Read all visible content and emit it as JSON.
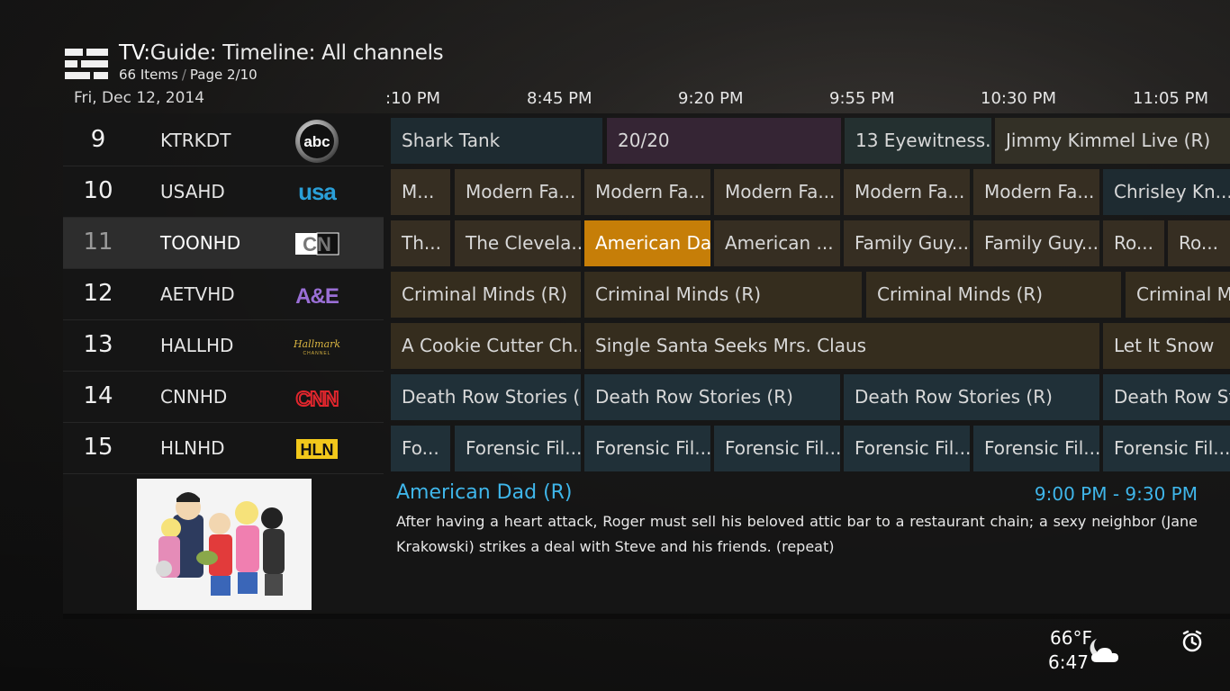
{
  "header": {
    "title_prefix": "TV:",
    "title_main": "Guide: Timeline: All channels",
    "items": "66 Items",
    "separator": "/",
    "page": "Page 2/10"
  },
  "date": "Fri, Dec 12, 2014",
  "timeline": [
    ":10 PM",
    "8:45 PM",
    "9:20 PM",
    "9:55 PM",
    "10:30 PM",
    "11:05 PM"
  ],
  "channels": [
    {
      "number": "9",
      "name": "KTRKDT",
      "logo": "abc",
      "active": false
    },
    {
      "number": "10",
      "name": "USAHD",
      "logo": "usa",
      "active": false
    },
    {
      "number": "11",
      "name": "TOONHD",
      "logo": "cn",
      "active": true
    },
    {
      "number": "12",
      "name": "AETVHD",
      "logo": "ae",
      "active": false
    },
    {
      "number": "13",
      "name": "HALLHD",
      "logo": "hallmark",
      "active": false
    },
    {
      "number": "14",
      "name": "CNNHD",
      "logo": "cnn",
      "active": false
    },
    {
      "number": "15",
      "name": "HLNHD",
      "logo": "hln",
      "active": false
    }
  ],
  "logos": {
    "abc": "abc",
    "usa": "usa",
    "cn": "CN",
    "ae": "A&E",
    "hallmark": "Hallmark",
    "hallmark_sub": "CHANNEL",
    "cnn": "CNN",
    "hln": "HLN"
  },
  "programs": [
    [
      {
        "title": "Shark Tank",
        "genre": "reality"
      },
      {
        "title": "20/20",
        "genre": "variety"
      },
      {
        "title": "13 Eyewitness...",
        "genre": "local"
      },
      {
        "title": "Jimmy Kimmel Live (R)",
        "genre": "talk"
      }
    ],
    [
      {
        "title": "M...",
        "genre": "comedy"
      },
      {
        "title": "Modern Fa...",
        "genre": "comedy"
      },
      {
        "title": "Modern Fa...",
        "genre": "comedy"
      },
      {
        "title": "Modern Fa...",
        "genre": "comedy"
      },
      {
        "title": "Modern Fa...",
        "genre": "comedy"
      },
      {
        "title": "Modern Fa...",
        "genre": "comedy"
      },
      {
        "title": "Chrisley Kn...",
        "genre": "reality"
      }
    ],
    [
      {
        "title": "Th...",
        "genre": "comedy"
      },
      {
        "title": "The Clevela...",
        "genre": "comedy"
      },
      {
        "title": "American Da",
        "genre": "comedy",
        "selected": true
      },
      {
        "title": "American ...",
        "genre": "comedy"
      },
      {
        "title": "Family Guy...",
        "genre": "comedy"
      },
      {
        "title": "Family Guy...",
        "genre": "comedy"
      },
      {
        "title": "Ro...",
        "genre": "comedy"
      },
      {
        "title": "Ro...",
        "genre": "comedy"
      }
    ],
    [
      {
        "title": "Criminal Minds (R)",
        "genre": "drama"
      },
      {
        "title": "Criminal Minds (R)",
        "genre": "drama"
      },
      {
        "title": "Criminal Minds (R)",
        "genre": "drama"
      },
      {
        "title": "Criminal Mi",
        "genre": "drama"
      }
    ],
    [
      {
        "title": "A Cookie Cutter Ch...",
        "genre": "drama"
      },
      {
        "title": "Single Santa Seeks Mrs. Claus",
        "genre": "drama"
      },
      {
        "title": "Let It Snow",
        "genre": "drama"
      }
    ],
    [
      {
        "title": "Death Row Stories (R)",
        "genre": "doc"
      },
      {
        "title": "Death Row Stories (R)",
        "genre": "doc"
      },
      {
        "title": "Death Row Stories (R)",
        "genre": "doc"
      },
      {
        "title": "Death Row Stor",
        "genre": "doc"
      }
    ],
    [
      {
        "title": "Fo...",
        "genre": "doc"
      },
      {
        "title": "Forensic Fil...",
        "genre": "doc"
      },
      {
        "title": "Forensic Fil...",
        "genre": "doc"
      },
      {
        "title": "Forensic Fil...",
        "genre": "doc"
      },
      {
        "title": "Forensic Fil...",
        "genre": "doc"
      },
      {
        "title": "Forensic Fil...",
        "genre": "doc"
      },
      {
        "title": "Forensic Fil...",
        "genre": "doc"
      }
    ]
  ],
  "details": {
    "title": "American Dad (R)",
    "time": "9:00 PM - 9:30 PM",
    "description": "After having a heart attack, Roger must sell his beloved attic bar to a restaurant chain; a sexy neighbor (Jane Krakowski) strikes a deal with Steve and his friends. (repeat)"
  },
  "status": {
    "temperature": "66°F",
    "time": "6:47",
    "weather_icon": "partly-cloudy-night-icon",
    "alarm_icon": "alarm-clock-icon"
  },
  "colors": {
    "accent": "#3fb6ea",
    "selected": "#c67e08"
  }
}
